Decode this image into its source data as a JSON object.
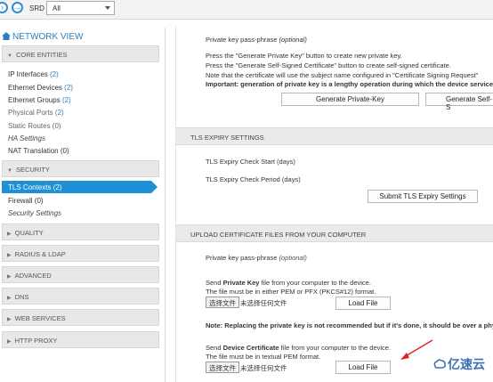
{
  "toolbar": {
    "back_icon": "arrow-left-icon",
    "forward_icon": "arrow-right-icon",
    "srd_label": "SRD",
    "srd_value": "All"
  },
  "sidebar": {
    "title": "NETWORK VIEW",
    "core_entities": "CORE ENTITIES",
    "core_items": [
      {
        "label": "IP Interfaces",
        "count": "(2)"
      },
      {
        "label": "Ethernet Devices",
        "count": "(2)"
      },
      {
        "label": "Ethernet Groups",
        "count": "(2)"
      },
      {
        "label": "Physical Ports",
        "count": "(2)"
      },
      {
        "label": "Static Routes (0)"
      },
      {
        "label": "HA Settings"
      },
      {
        "label": "NAT Translation (0)"
      }
    ],
    "security": "SECURITY",
    "security_items": [
      {
        "label": "TLS Contexts (2)"
      },
      {
        "label": "Firewall (0)"
      },
      {
        "label": "Security Settings"
      }
    ],
    "sections": [
      "QUALITY",
      "RADIUS & LDAP",
      "ADVANCED",
      "DNS",
      "WEB SERVICES",
      "HTTP PROXY"
    ]
  },
  "main": {
    "private_key_label": "Private key pass-phrase",
    "optional": "(optional)",
    "generate_desc_1": "Press the \"Generate Private Key\" button to create new private key.",
    "generate_desc_2": "Press the \"Generate Self-Signed Certificate\" button to create self-signed certificate.",
    "generate_desc_3": "Note that the certificate will use the subject name configured in \"Certificate Signing Request\"",
    "generate_important": "Important: generation of private key is a lengthy operation during which the device service m",
    "generate_private_key_button": "Generate Private-Key",
    "generate_self_signed_button": "Generate Self-S",
    "tls_expiry_header": "TLS EXPIRY SETTINGS",
    "tls_expiry_start": "TLS Expiry Check Start (days)",
    "tls_expiry_period": "TLS Expiry Check Period (days)",
    "submit_tls_button": "Submit TLS Expiry Settings",
    "upload_header": "UPLOAD CERTIFICATE FILES FROM YOUR COMPUTER",
    "upload_private_key_label": "Private key pass-phrase",
    "send_private_key_prefix": "Send ",
    "send_private_key_bold": "Private Key",
    "send_private_key_suffix": " file from your computer to the device.",
    "private_key_format": "The file must be in either PEM or PFX (PKCS#12) format.",
    "choose_file": "选择文件",
    "no_file": "未选择任何文件",
    "load_file": "Load File",
    "replace_note": "Note: Replacing the private key is not recommended but if it's done, it should be over a physi",
    "send_cert_prefix": "Send ",
    "send_cert_bold": "Device Certificate",
    "send_cert_suffix": " file from your computer to the device.",
    "cert_format": "The file must be in textual PEM format."
  },
  "watermark": {
    "text": "亿速云"
  },
  "colors": {
    "accent": "#1f8fd6",
    "header_bg": "#eaeaea",
    "arrow": "#e02424"
  }
}
